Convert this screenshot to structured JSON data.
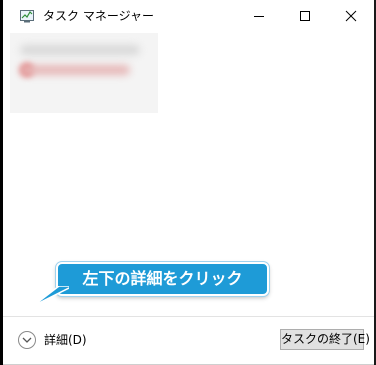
{
  "window": {
    "title": "タスク マネージャー",
    "icon": "task-manager-icon"
  },
  "window_controls": {
    "minimize": "minimize-icon",
    "maximize": "maximize-icon",
    "close": "close-icon"
  },
  "callout": {
    "text": "左下の詳細をクリック",
    "color": "#1e9bd7"
  },
  "footer": {
    "details_label": "詳細(D)",
    "details_icon": "chevron-down-icon",
    "end_task_label": "タスクの終了(E)"
  }
}
